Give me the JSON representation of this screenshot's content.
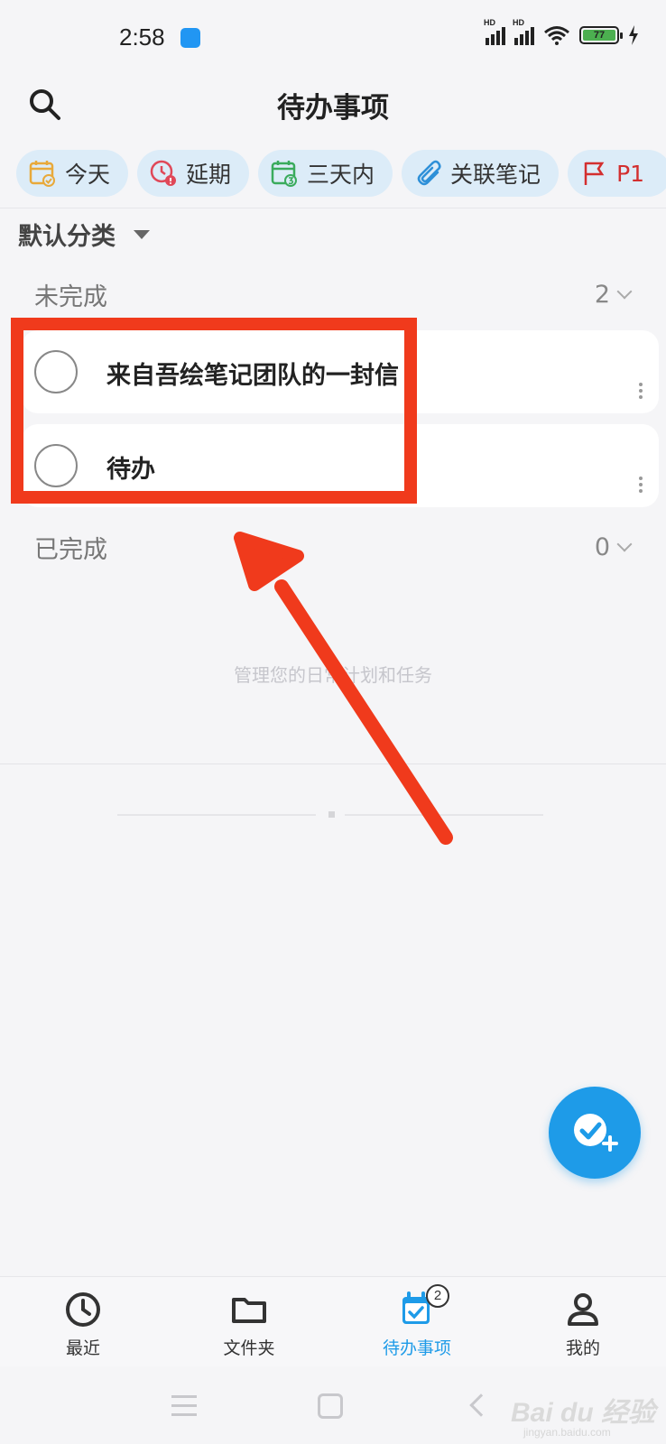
{
  "status_bar": {
    "time": "2:58",
    "battery": "77",
    "network_labels": [
      "HD",
      "HD"
    ]
  },
  "header": {
    "title": "待办事项"
  },
  "filter_chips": [
    {
      "label": "今天",
      "icon": "calendar-check-icon",
      "color": "#e8a93a"
    },
    {
      "label": "延期",
      "icon": "overdue-clock-icon",
      "color": "#e04858"
    },
    {
      "label": "三天内",
      "icon": "calendar-three-icon",
      "color": "#3aab5c"
    },
    {
      "label": "关联笔记",
      "icon": "paperclip-icon",
      "color": "#2e90d8"
    },
    {
      "label": "P1",
      "icon": "flag-icon",
      "color": "#d32f2f"
    }
  ],
  "category": {
    "label": "默认分类"
  },
  "sections": {
    "incomplete": {
      "label": "未完成",
      "count": "2"
    },
    "completed": {
      "label": "已完成",
      "count": "0"
    }
  },
  "tasks": [
    {
      "title": "来自吾绘笔记团队的一封信"
    },
    {
      "title": "待办"
    }
  ],
  "empty_hint": "管理您的日常计划和任务",
  "bottom_nav": {
    "items": [
      {
        "label": "最近",
        "icon": "clock-icon"
      },
      {
        "label": "文件夹",
        "icon": "folder-icon"
      },
      {
        "label": "待办事项",
        "icon": "todo-calendar-icon",
        "badge": "2",
        "active": true
      },
      {
        "label": "我的",
        "icon": "person-icon"
      }
    ]
  },
  "colors": {
    "accent": "#1e9be8",
    "annotation": "#f03a1c",
    "chip_bg": "#dcecf8"
  },
  "watermark": {
    "text": "Bai du 经验",
    "sub": "jingyan.baidu.com"
  }
}
